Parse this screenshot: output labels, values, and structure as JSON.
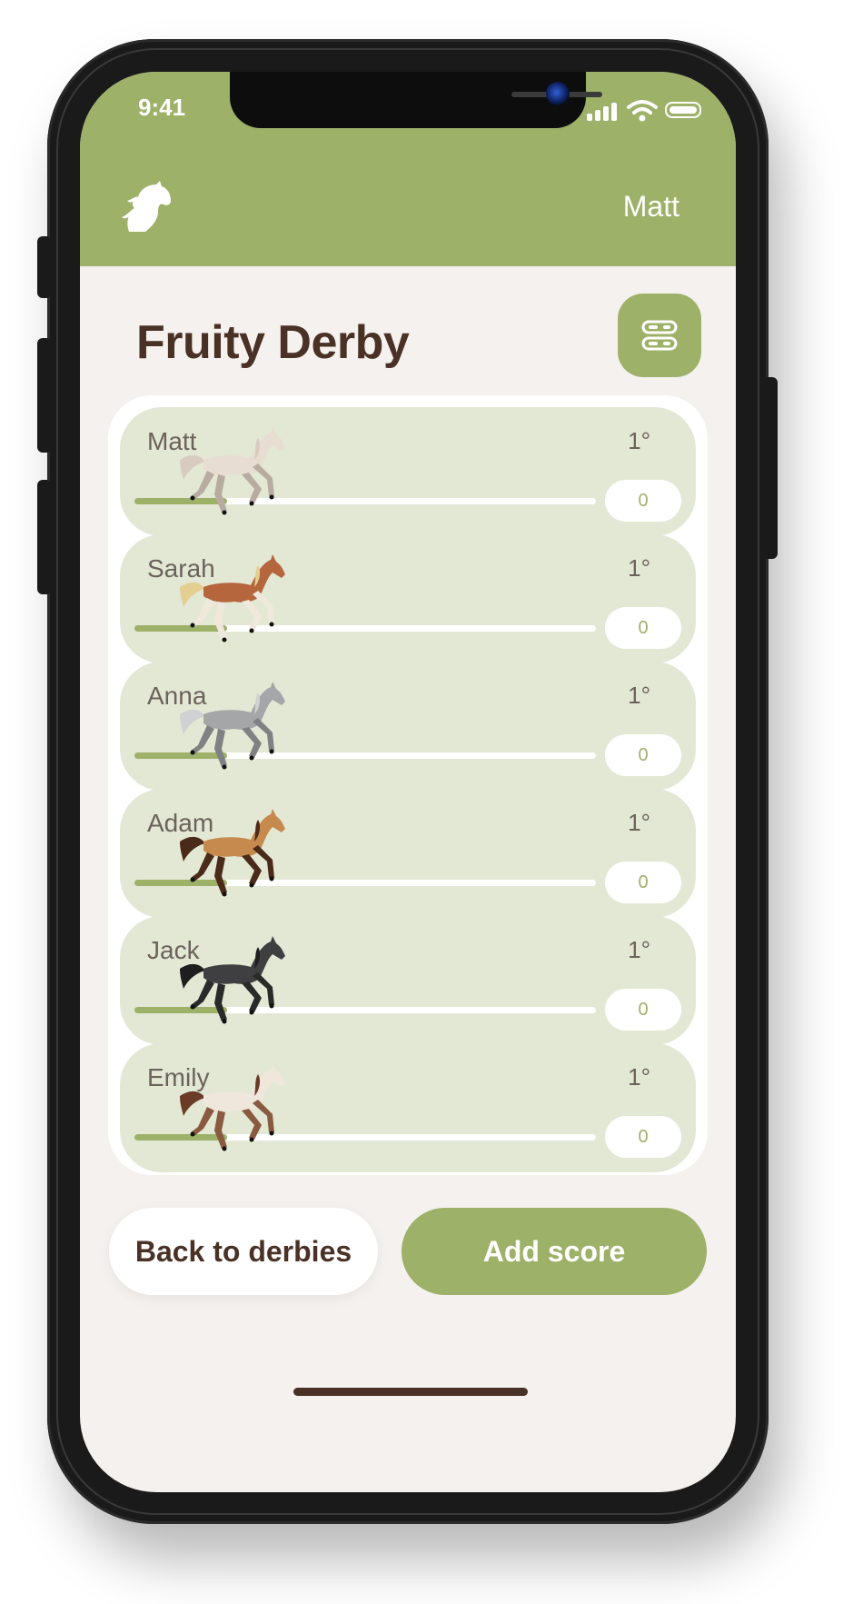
{
  "status_bar": {
    "time": "9:41"
  },
  "header": {
    "user_name": "Matt",
    "logo_icon": "horse-head-icon"
  },
  "page": {
    "title": "Fruity Derby",
    "settings_icon": "toggles-icon"
  },
  "players": [
    {
      "name": "Matt",
      "rank": "1°",
      "score": "0",
      "progress": 0.2,
      "horse": {
        "body": "#e8ddd2",
        "mane": "#d8ccc0",
        "legs": "#b8aca2"
      }
    },
    {
      "name": "Sarah",
      "rank": "1°",
      "score": "0",
      "progress": 0.2,
      "horse": {
        "body": "#b5663c",
        "mane": "#e3cf92",
        "legs": "#f0e8dc"
      }
    },
    {
      "name": "Anna",
      "rank": "1°",
      "score": "0",
      "progress": 0.2,
      "horse": {
        "body": "#a4a6a8",
        "mane": "#cfd1d2",
        "legs": "#7f8183"
      }
    },
    {
      "name": "Adam",
      "rank": "1°",
      "score": "0",
      "progress": 0.2,
      "horse": {
        "body": "#c78a4e",
        "mane": "#4a2a18",
        "legs": "#4a2a18"
      }
    },
    {
      "name": "Jack",
      "rank": "1°",
      "score": "0",
      "progress": 0.2,
      "horse": {
        "body": "#3f3f41",
        "mane": "#1e1e1f",
        "legs": "#2a2a2b"
      }
    },
    {
      "name": "Emily",
      "rank": "1°",
      "score": "0",
      "progress": 0.2,
      "horse": {
        "body": "#efe6dc",
        "mane": "#6a3b26",
        "legs": "#8a5a40"
      }
    }
  ],
  "actions": {
    "back_label": "Back to derbies",
    "add_label": "Add score"
  },
  "colors": {
    "accent": "#9db168",
    "brown": "#4a3126",
    "row_bg": "#e3e8d5",
    "page_bg": "#f5f1ee"
  }
}
